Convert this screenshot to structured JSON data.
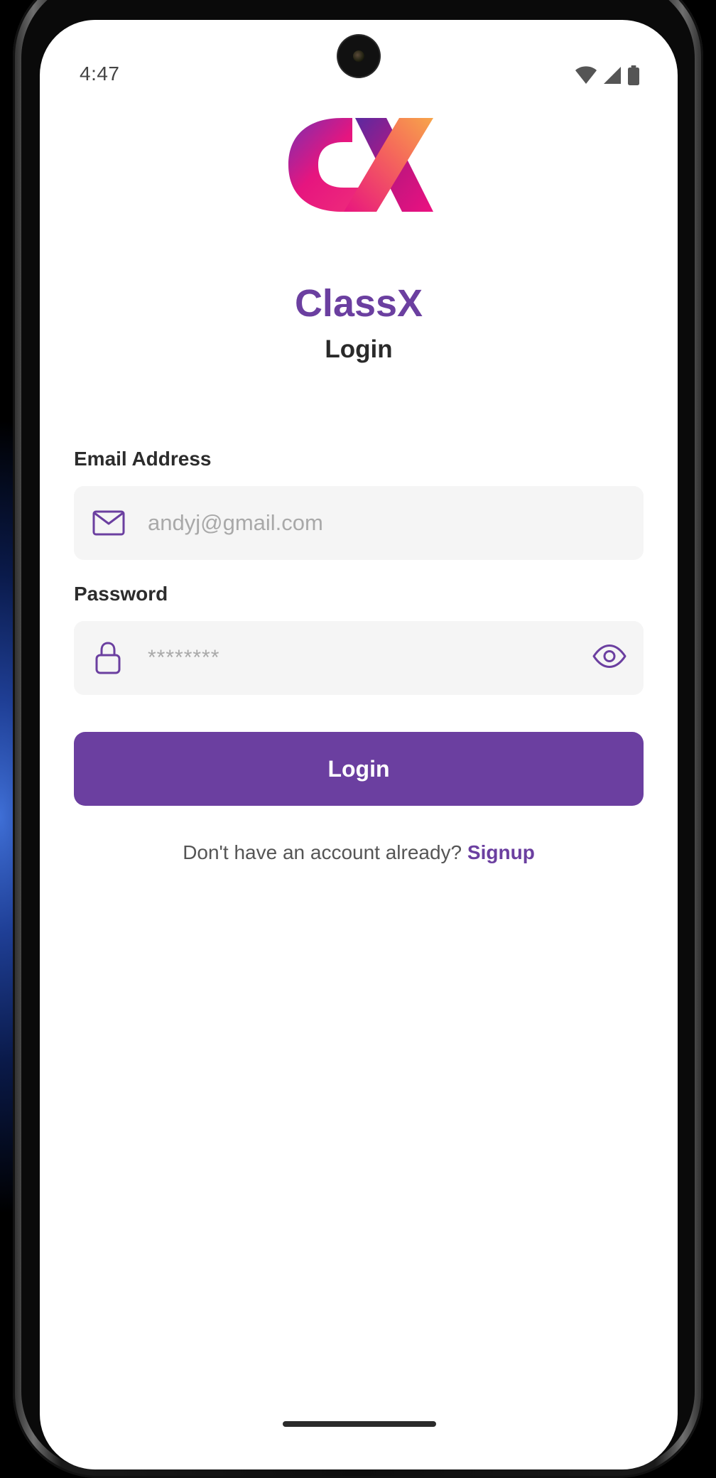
{
  "status_bar": {
    "time": "4:47",
    "icons": [
      "wifi-icon",
      "cellular-signal-icon",
      "battery-icon"
    ]
  },
  "app": {
    "logo_text": "CX",
    "name": "ClassX",
    "screen_title": "Login"
  },
  "form": {
    "email": {
      "label": "Email Address",
      "placeholder": "andyj@gmail.com",
      "icon": "mail-icon"
    },
    "password": {
      "label": "Password",
      "placeholder": "********",
      "icon": "lock-icon",
      "toggle_icon": "eye-icon"
    },
    "submit_label": "Login"
  },
  "footer": {
    "prompt": "Don't have an account already?",
    "link": "Signup"
  },
  "colors": {
    "accent": "#6b3fa0",
    "field_bg": "#f5f5f5",
    "logo_gradient": [
      "#6a3aa8",
      "#e6157f",
      "#f7a54a"
    ]
  }
}
